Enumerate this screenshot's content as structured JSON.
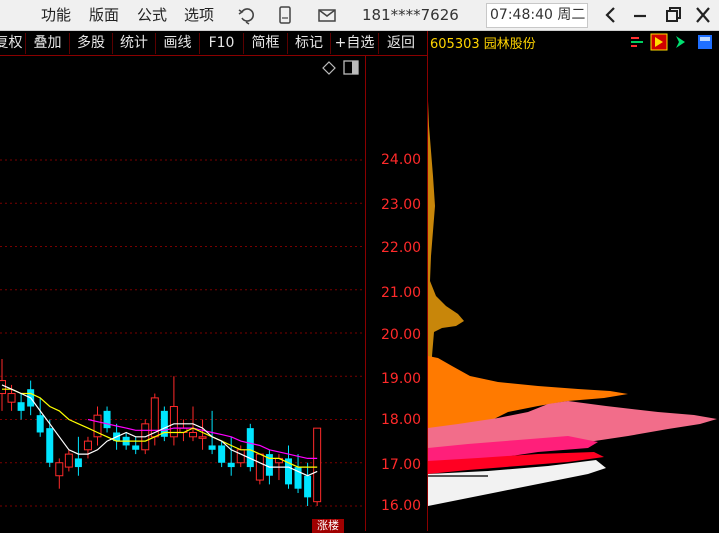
{
  "menu": [
    "功能",
    "版面",
    "公式",
    "选项"
  ],
  "phone_masked": "181****7626",
  "clock": "07:48:40 周二",
  "toolbar": [
    "复权",
    "叠加",
    "多股",
    "统计",
    "画线",
    "F10",
    "简框",
    "标记",
    "+自选",
    "返回"
  ],
  "stock": {
    "code": "605303",
    "name": "园林股份"
  },
  "price_axis": [
    "24.00",
    "23.00",
    "22.00",
    "21.00",
    "20.00",
    "19.00",
    "18.00",
    "17.00",
    "16.00"
  ],
  "tag_label": "涨楼",
  "colors": {
    "up": "#ff2a2a",
    "down": "#00e5ff",
    "ma5": "#ffffff",
    "ma10": "#ffff00",
    "ma20": "#ff00ff",
    "chip_gold": "#c8860a",
    "chip_orange": "#ff7a00",
    "chip_pink": "#f26d8a",
    "chip_magenta": "#ff1f7a",
    "chip_red": "#ff0022",
    "chip_white": "#f2f2f2"
  },
  "icons": [
    "refresh-icon",
    "phone-icon",
    "mail-icon",
    "back-icon",
    "minimize-icon",
    "restore-icon",
    "close-icon",
    "diamond-icon",
    "panel-icon",
    "bars-icon",
    "flag-icon",
    "arrow-icon",
    "layout-icon"
  ],
  "chart_data": {
    "type": "candlestick",
    "ylim": [
      15.8,
      24.8
    ],
    "candles": [
      {
        "o": 18.6,
        "h": 19.4,
        "l": 18.2,
        "c": 18.9
      },
      {
        "o": 18.4,
        "h": 18.8,
        "l": 18.2,
        "c": 18.6
      },
      {
        "o": 18.4,
        "h": 18.6,
        "l": 18.0,
        "c": 18.2
      },
      {
        "o": 18.7,
        "h": 18.9,
        "l": 18.1,
        "c": 18.3
      },
      {
        "o": 18.1,
        "h": 18.5,
        "l": 17.6,
        "c": 17.7
      },
      {
        "o": 17.8,
        "h": 18.0,
        "l": 16.9,
        "c": 17.0
      },
      {
        "o": 16.7,
        "h": 17.1,
        "l": 16.4,
        "c": 17.0
      },
      {
        "o": 16.9,
        "h": 17.3,
        "l": 16.8,
        "c": 17.2
      },
      {
        "o": 17.1,
        "h": 17.6,
        "l": 16.7,
        "c": 16.9
      },
      {
        "o": 17.3,
        "h": 17.6,
        "l": 17.1,
        "c": 17.5
      },
      {
        "o": 17.6,
        "h": 18.3,
        "l": 17.4,
        "c": 18.1
      },
      {
        "o": 18.2,
        "h": 18.3,
        "l": 17.7,
        "c": 17.8
      },
      {
        "o": 17.7,
        "h": 17.9,
        "l": 17.3,
        "c": 17.5
      },
      {
        "o": 17.6,
        "h": 17.7,
        "l": 17.3,
        "c": 17.4
      },
      {
        "o": 17.4,
        "h": 17.6,
        "l": 17.2,
        "c": 17.3
      },
      {
        "o": 17.3,
        "h": 18.0,
        "l": 17.2,
        "c": 17.9
      },
      {
        "o": 17.6,
        "h": 18.6,
        "l": 17.4,
        "c": 18.5
      },
      {
        "o": 18.2,
        "h": 18.3,
        "l": 17.5,
        "c": 17.6
      },
      {
        "o": 17.6,
        "h": 19.0,
        "l": 17.4,
        "c": 18.3
      },
      {
        "o": 17.7,
        "h": 18.0,
        "l": 17.5,
        "c": 17.8
      },
      {
        "o": 17.6,
        "h": 18.3,
        "l": 17.5,
        "c": 17.7
      },
      {
        "o": 17.6,
        "h": 18.0,
        "l": 17.3,
        "c": 17.6
      },
      {
        "o": 17.4,
        "h": 18.2,
        "l": 17.2,
        "c": 17.3
      },
      {
        "o": 17.4,
        "h": 17.5,
        "l": 16.9,
        "c": 17.0
      },
      {
        "o": 17.0,
        "h": 17.6,
        "l": 16.7,
        "c": 16.9
      },
      {
        "o": 17.0,
        "h": 17.4,
        "l": 16.9,
        "c": 17.3
      },
      {
        "o": 17.8,
        "h": 17.9,
        "l": 16.8,
        "c": 16.9
      },
      {
        "o": 16.6,
        "h": 17.2,
        "l": 16.5,
        "c": 17.2
      },
      {
        "o": 17.2,
        "h": 17.3,
        "l": 16.5,
        "c": 16.7
      },
      {
        "o": 17.0,
        "h": 17.2,
        "l": 16.6,
        "c": 17.1
      },
      {
        "o": 17.1,
        "h": 17.4,
        "l": 16.4,
        "c": 16.5
      },
      {
        "o": 16.9,
        "h": 17.2,
        "l": 16.3,
        "c": 16.4
      },
      {
        "o": 16.7,
        "h": 17.0,
        "l": 16.0,
        "c": 16.2
      },
      {
        "o": 16.1,
        "h": 17.8,
        "l": 16.0,
        "c": 17.8
      }
    ],
    "ma5": [
      18.8,
      18.7,
      18.6,
      18.5,
      18.2,
      17.9,
      17.6,
      17.3,
      17.2,
      17.2,
      17.3,
      17.5,
      17.6,
      17.7,
      17.6,
      17.6,
      17.7,
      17.8,
      17.9,
      17.9,
      17.9,
      17.8,
      17.6,
      17.5,
      17.3,
      17.2,
      17.1,
      17.0,
      16.9,
      16.9,
      16.9,
      16.8,
      16.7,
      16.8
    ],
    "ma10": [
      18.7,
      18.7,
      18.6,
      18.6,
      18.5,
      18.3,
      18.2,
      18.0,
      17.9,
      17.8,
      17.7,
      17.6,
      17.5,
      17.5,
      17.5,
      17.5,
      17.6,
      17.7,
      17.7,
      17.7,
      17.8,
      17.7,
      17.6,
      17.5,
      17.4,
      17.3,
      17.3,
      17.2,
      17.1,
      17.1,
      17.0,
      16.9,
      16.9,
      16.9
    ],
    "ma20": [
      null,
      null,
      null,
      null,
      null,
      null,
      null,
      null,
      null,
      18.0,
      17.95,
      17.9,
      17.85,
      17.8,
      17.75,
      17.75,
      17.75,
      17.75,
      17.8,
      17.8,
      17.8,
      17.75,
      17.7,
      17.65,
      17.6,
      17.5,
      17.45,
      17.4,
      17.3,
      17.25,
      17.2,
      17.15,
      17.1,
      17.1
    ]
  }
}
